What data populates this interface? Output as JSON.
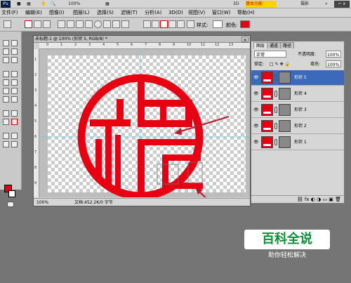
{
  "titlebar": {
    "zoom": "100%",
    "btn_3d": "3D",
    "jiben": "基本功能",
    "sheying": "摄影"
  },
  "menubar": {
    "items": [
      {
        "label": "文件(F)"
      },
      {
        "label": "编辑(E)"
      },
      {
        "label": "图像(I)"
      },
      {
        "label": "图层(L)"
      },
      {
        "label": "选择(S)"
      },
      {
        "label": "滤镜(T)"
      },
      {
        "label": "分析(A)"
      },
      {
        "label": "3D(D)"
      },
      {
        "label": "视图(V)"
      },
      {
        "label": "窗口(W)"
      },
      {
        "label": "帮助(H)"
      }
    ]
  },
  "options_bar": {
    "style_label": "样式:",
    "color_label": "颜色:",
    "color_value": "#e60012"
  },
  "document": {
    "title": "未标题-1 @ 100% (形状 5, RGB/8) *",
    "zoom": "100%",
    "doc_info": "文档:452.2K/0 字节",
    "ruler_top": [
      "0",
      "1",
      "2",
      "3",
      "4",
      "5",
      "6",
      "7",
      "8",
      "9",
      "10",
      "11",
      "12",
      "13"
    ],
    "ruler_left": [
      "1",
      "2",
      "3",
      "4",
      "5",
      "6",
      "7",
      "8",
      "9"
    ]
  },
  "layers_panel": {
    "tabs": [
      "图层",
      "通道",
      "路径"
    ],
    "blend_mode": "正常",
    "opacity_label": "不透明度:",
    "opacity_value": "100%",
    "lock_label": "锁定:",
    "fill_label": "填充:",
    "fill_value": "100%",
    "layers": [
      {
        "name": "形状 5",
        "selected": true
      },
      {
        "name": "形状 4",
        "selected": false
      },
      {
        "name": "形状 3",
        "selected": false
      },
      {
        "name": "形状 2",
        "selected": false
      },
      {
        "name": "形状 1",
        "selected": false
      }
    ]
  },
  "watermark": {
    "title": "百科全说",
    "subtitle": "助你轻松解决"
  }
}
